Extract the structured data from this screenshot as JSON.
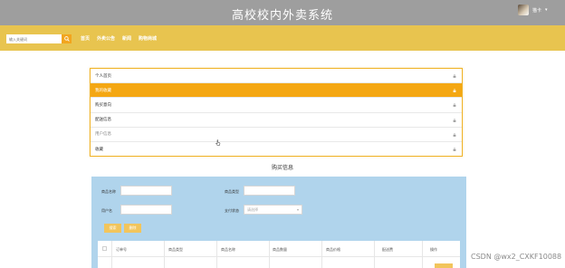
{
  "header": {
    "site_title": "高校校内外卖系统",
    "user_name": "猫卡",
    "user_caret": "▾"
  },
  "nav": {
    "search_placeholder": "输入关键词",
    "links": [
      "首页",
      "外卖公告",
      "新闻",
      "购物商城"
    ]
  },
  "menu": {
    "items": [
      {
        "label": "个人首页"
      },
      {
        "label": "我的收藏"
      },
      {
        "label": "购买意向"
      },
      {
        "label": "配送信息"
      },
      {
        "label": "用户信息"
      },
      {
        "label": "收藏"
      }
    ],
    "active_index": 1
  },
  "purchase": {
    "title": "购买信息",
    "fields": {
      "product_name_label": "商品名称",
      "product_type_label": "商品类型",
      "username_label": "用户名",
      "pay_status_label": "支付状态",
      "pay_status_placeholder": "请选择"
    },
    "buttons": {
      "search": "搜索",
      "delete": "删除"
    },
    "table": {
      "headers": [
        "订单号",
        "商品类型",
        "商品名称",
        "商品数量",
        "商品价格",
        "配送费",
        "操作"
      ]
    }
  },
  "watermark": "CSDN @wx2_CXKF10088",
  "colors": {
    "topbar": "#9e9e9e",
    "nav_band": "#e8c44f",
    "accent_orange": "#f4a712",
    "panel_blue": "#b0d4ec",
    "button_yellow": "#f2c55c"
  }
}
